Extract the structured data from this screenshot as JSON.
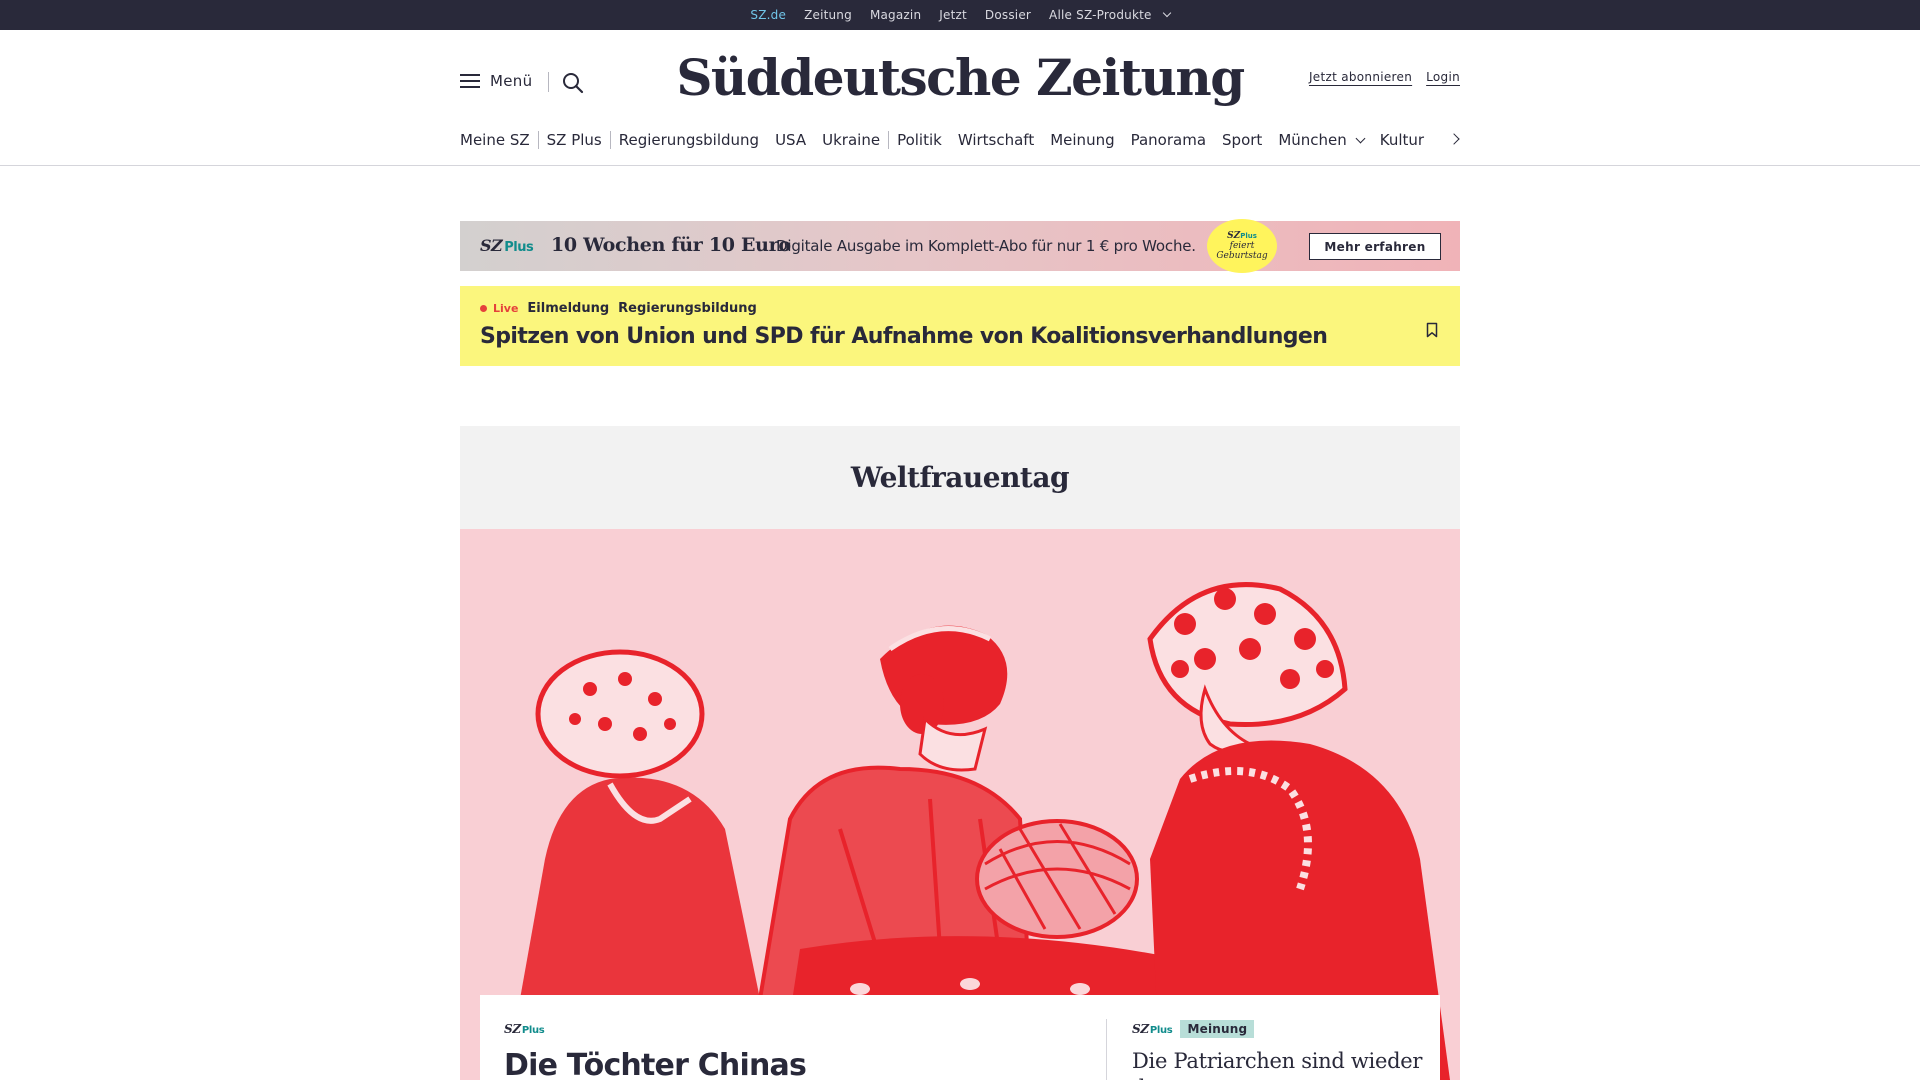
{
  "topbar": {
    "links": [
      {
        "label": "SZ.de",
        "active": true
      },
      {
        "label": "Zeitung",
        "active": false
      },
      {
        "label": "Magazin",
        "active": false
      },
      {
        "label": "Jetzt",
        "active": false
      },
      {
        "label": "Dossier",
        "active": false
      }
    ],
    "products_label": "Alle SZ-Produkte",
    "active_color": "#71c5e8",
    "background": "#29293a"
  },
  "header": {
    "menu_label": "Menü",
    "logo_text": "Süddeutsche Zeitung",
    "subscribe_label": "Jetzt abonnieren",
    "login_label": "Login",
    "search_icon": "search-icon",
    "menu_icon": "hamburger-icon"
  },
  "ressorts": {
    "items": [
      {
        "label": "Meine SZ",
        "separator": true
      },
      {
        "label": "SZ Plus",
        "separator": true
      },
      {
        "label": "Regierungsbildung",
        "separator": false
      },
      {
        "label": "USA",
        "separator": false
      },
      {
        "label": "Ukraine",
        "separator": true
      },
      {
        "label": "Politik",
        "separator": false
      },
      {
        "label": "Wirtschaft",
        "separator": false
      },
      {
        "label": "Meinung",
        "separator": false
      },
      {
        "label": "Panorama",
        "separator": false
      },
      {
        "label": "Sport",
        "separator": false
      },
      {
        "label": "München",
        "separator": false,
        "dropdown": true
      },
      {
        "label": "Kultur",
        "separator": false
      }
    ],
    "next_icon": "chevron-right-icon"
  },
  "promo": {
    "logo_sz": "SZ",
    "logo_plus": "Plus",
    "headline": "10 Wochen für 10 Euro",
    "text": "Digitale Ausgabe im Komplett-Abo für nur 1 € pro Woche.",
    "badge_line1": "feiert",
    "badge_line2": "Geburtstag",
    "cta_label": "Mehr erfahren"
  },
  "breaking": {
    "live_label": "Live",
    "type_label": "Eilmeldung",
    "topic_label": "Regierungsbildung",
    "title": "Spitzen von Union und SPD für Aufnahme von Koalitionsverhandlungen",
    "live_color": "#e5413b",
    "background": "#fbf67d"
  },
  "topic": {
    "title": "Weltfrauentag",
    "hero_image": "illustration-three-women-red-ink"
  },
  "cards": {
    "main": {
      "sz": "SZ",
      "plus": "Plus",
      "title": "Die Töchter Chinas"
    },
    "side": {
      "sz": "SZ",
      "plus": "Plus",
      "badge": "Meinung",
      "title": "Die Patriarchen sind wieder d"
    }
  }
}
